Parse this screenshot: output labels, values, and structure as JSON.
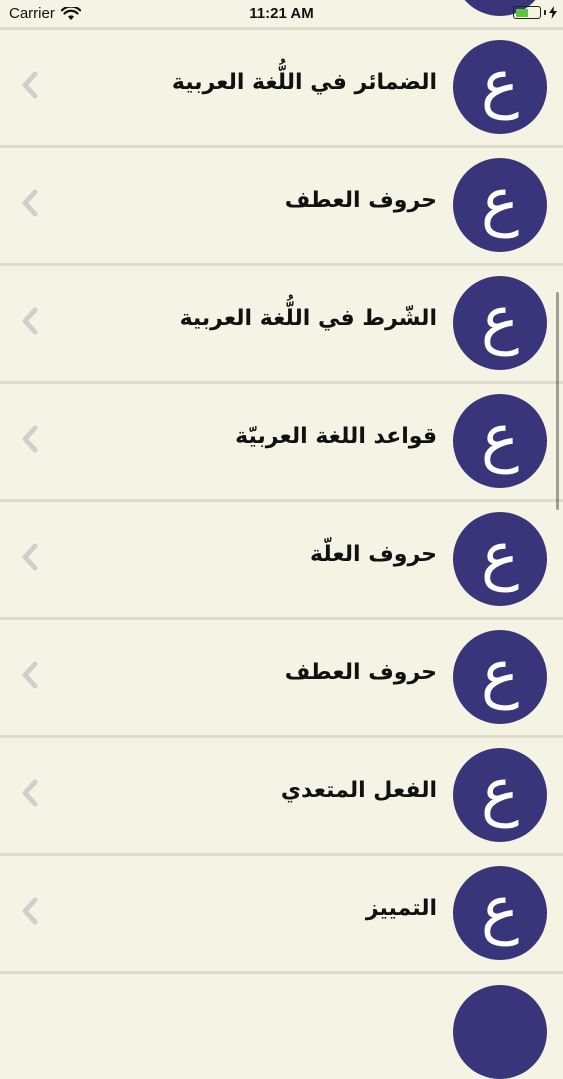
{
  "status_bar": {
    "carrier": "Carrier",
    "time": "11:21 AM",
    "battery_color": "#5bc640",
    "icons": [
      "wifi-icon",
      "battery-icon",
      "charging-bolt-icon"
    ]
  },
  "list": {
    "badge_letter": "ع",
    "badge_color": "#39357a",
    "chevron_icon": "chevron-left-icon",
    "items": [
      {
        "title": "الضمائر في اللُّغة العربية"
      },
      {
        "title": "حروف العطف"
      },
      {
        "title": "الشّرط في اللُّغة العربية"
      },
      {
        "title": "قواعد اللغة العربيّة"
      },
      {
        "title": "حروف العلّة"
      },
      {
        "title": "حروف العطف"
      },
      {
        "title": "الفعل المتعدي"
      },
      {
        "title": "التمييز"
      }
    ]
  }
}
